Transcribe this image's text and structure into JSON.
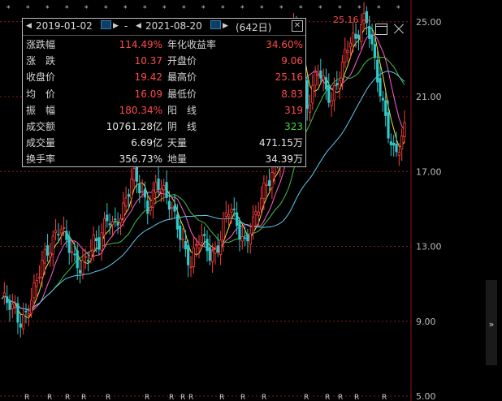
{
  "range": {
    "start_date": "2019-01-02",
    "separator": "-",
    "end_date": "2021-08-20",
    "count": "(642日)"
  },
  "stats_left": [
    {
      "label": "涨跌幅",
      "value": "114.49%",
      "color": "red"
    },
    {
      "label": "涨　跌",
      "value": "10.37",
      "color": "red"
    },
    {
      "label": "收盘价",
      "value": "19.42",
      "color": "red"
    },
    {
      "label": "均　价",
      "value": "16.09",
      "color": "red"
    },
    {
      "label": "振　幅",
      "value": "180.34%",
      "color": "red"
    },
    {
      "label": "成交额",
      "value": "10761.28亿",
      "color": "white"
    },
    {
      "label": "成交量",
      "value": "6.69亿",
      "color": "white"
    },
    {
      "label": "换手率",
      "value": "356.73%",
      "color": "white"
    }
  ],
  "stats_right": [
    {
      "label": "年化收益率",
      "value": "34.60%",
      "color": "red"
    },
    {
      "label": "开盘价",
      "value": "9.06",
      "color": "red"
    },
    {
      "label": "最高价",
      "value": "25.16",
      "color": "red"
    },
    {
      "label": "最低价",
      "value": "8.83",
      "color": "red"
    },
    {
      "label": "阳　线",
      "value": "319",
      "color": "red"
    },
    {
      "label": "阴　线",
      "value": "323",
      "color": "green"
    },
    {
      "label": "天量",
      "value": "471.15万",
      "color": "white"
    },
    {
      "label": "地量",
      "value": "34.39万",
      "color": "white"
    }
  ],
  "chart_data": {
    "type": "candlestick",
    "y_ticks": [
      "25.00",
      "21.00",
      "17.00",
      "13.00",
      "9.00",
      "5.00"
    ],
    "ylim": [
      5,
      25.9
    ],
    "peak_label": "25.16",
    "colors": {
      "up": "#ff3c3c",
      "down": "#30c8c8",
      "ma_short": "#f0e040",
      "ma_mid": "#ff60d0",
      "ma_long": "#40c040",
      "ma_xlong": "#60c8f0",
      "grid": "#8a1a1a",
      "axis_line": "#8a1a1a"
    },
    "close_path": [
      10.2,
      9.9,
      9.6,
      9.3,
      9.0,
      9.6,
      10.2,
      10.9,
      11.6,
      12.4,
      12.9,
      13.8,
      14.4,
      13.6,
      12.8,
      12.0,
      11.7,
      12.2,
      12.9,
      13.5,
      13.1,
      13.8,
      14.4,
      14.0,
      14.6,
      15.2,
      15.9,
      16.8,
      16.2,
      15.6,
      15.0,
      15.8,
      16.7,
      16.1,
      15.4,
      14.8,
      14.2,
      13.6,
      12.8,
      12.2,
      12.9,
      13.4,
      12.9,
      12.5,
      12.8,
      13.6,
      14.6,
      15.0,
      14.3,
      13.6,
      13.2,
      14.0,
      14.6,
      15.2,
      15.8,
      16.3,
      16.9,
      18.0,
      19.5,
      21.5,
      24.5,
      23.5,
      21.8,
      20.5,
      21.5,
      22.8,
      22.0,
      21.0,
      20.5,
      21.6,
      22.6,
      23.8,
      24.3,
      23.9,
      24.6,
      25.0,
      24.2,
      22.8,
      21.5,
      20.0,
      18.5,
      17.6,
      18.3,
      19.4
    ]
  }
}
